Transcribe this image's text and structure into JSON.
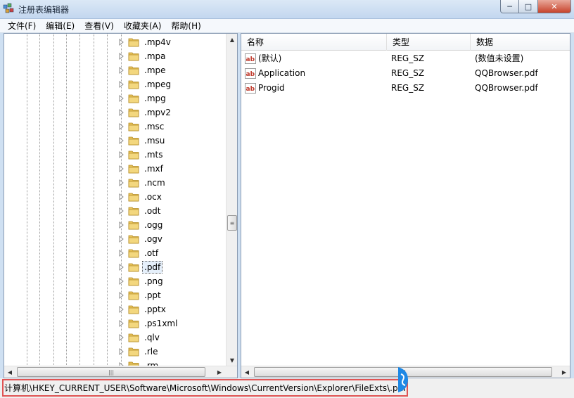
{
  "window": {
    "title": "注册表编辑器",
    "minimize": "─",
    "maximize": "□",
    "close": "✕"
  },
  "menu": [
    "文件(F)",
    "编辑(E)",
    "查看(V)",
    "收藏夹(A)",
    "帮助(H)"
  ],
  "tree": {
    "items": [
      {
        "label": ".mp4v",
        "selected": false
      },
      {
        "label": ".mpa",
        "selected": false
      },
      {
        "label": ".mpe",
        "selected": false
      },
      {
        "label": ".mpeg",
        "selected": false
      },
      {
        "label": ".mpg",
        "selected": false
      },
      {
        "label": ".mpv2",
        "selected": false
      },
      {
        "label": ".msc",
        "selected": false
      },
      {
        "label": ".msu",
        "selected": false
      },
      {
        "label": ".mts",
        "selected": false
      },
      {
        "label": ".mxf",
        "selected": false
      },
      {
        "label": ".ncm",
        "selected": false
      },
      {
        "label": ".ocx",
        "selected": false
      },
      {
        "label": ".odt",
        "selected": false
      },
      {
        "label": ".ogg",
        "selected": false
      },
      {
        "label": ".ogv",
        "selected": false
      },
      {
        "label": ".otf",
        "selected": false
      },
      {
        "label": ".pdf",
        "selected": true
      },
      {
        "label": ".png",
        "selected": false
      },
      {
        "label": ".ppt",
        "selected": false
      },
      {
        "label": ".pptx",
        "selected": false
      },
      {
        "label": ".ps1xml",
        "selected": false
      },
      {
        "label": ".qlv",
        "selected": false
      },
      {
        "label": ".rle",
        "selected": false
      },
      {
        "label": ".rm",
        "selected": false
      }
    ]
  },
  "list": {
    "columns": [
      "名称",
      "类型",
      "数据"
    ],
    "rows": [
      {
        "name": "(默认)",
        "type": "REG_SZ",
        "data": "(数值未设置)",
        "icon": "string-value-icon"
      },
      {
        "name": "Application",
        "type": "REG_SZ",
        "data": "QQBrowser.pdf",
        "icon": "string-value-icon"
      },
      {
        "name": "Progid",
        "type": "REG_SZ",
        "data": "QQBrowser.pdf",
        "icon": "string-value-icon"
      }
    ]
  },
  "statusbar": {
    "path": "计算机\\HKEY_CURRENT_USER\\Software\\Microsoft\\Windows\\CurrentVersion\\Explorer\\FileExts\\.pdf"
  },
  "colors": {
    "highlight_border": "#e05454",
    "folder": "#e8c35a",
    "selection": "#e6f0fb",
    "badge": "#1e88e5"
  }
}
